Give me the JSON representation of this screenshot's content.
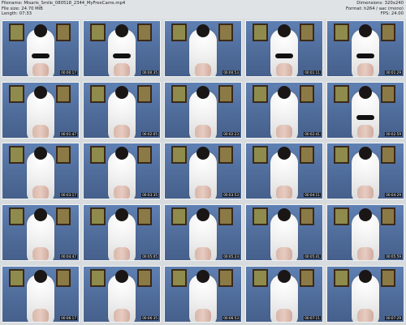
{
  "header": {
    "filename": "Filename: Misaris_Smile_080518_2344_MyFreeCams.mp4",
    "filesize": "File size: 24.70 MiB",
    "length": "Length: 07:33",
    "dimensions": "Dimensions: 320x240",
    "format": "Format: h264 / aac (mono)",
    "fps": "FPS: 24.00"
  },
  "thumbnails": [
    {
      "time": "00:00:17"
    },
    {
      "time": "00:00:35"
    },
    {
      "time": "00:00:53"
    },
    {
      "time": "00:01:11"
    },
    {
      "time": "00:01:29"
    },
    {
      "time": "00:01:47"
    },
    {
      "time": "00:02:05"
    },
    {
      "time": "00:02:23"
    },
    {
      "time": "00:02:41"
    },
    {
      "time": "00:02:59"
    },
    {
      "time": "00:03:17"
    },
    {
      "time": "00:03:35"
    },
    {
      "time": "00:03:53"
    },
    {
      "time": "00:04:11"
    },
    {
      "time": "00:04:29"
    },
    {
      "time": "00:04:47"
    },
    {
      "time": "00:05:05"
    },
    {
      "time": "00:05:23"
    },
    {
      "time": "00:05:41"
    },
    {
      "time": "00:05:59"
    },
    {
      "time": "00:06:17"
    },
    {
      "time": "00:06:35"
    },
    {
      "time": "00:06:53"
    },
    {
      "time": "00:07:11"
    },
    {
      "time": "00:07:29"
    }
  ]
}
